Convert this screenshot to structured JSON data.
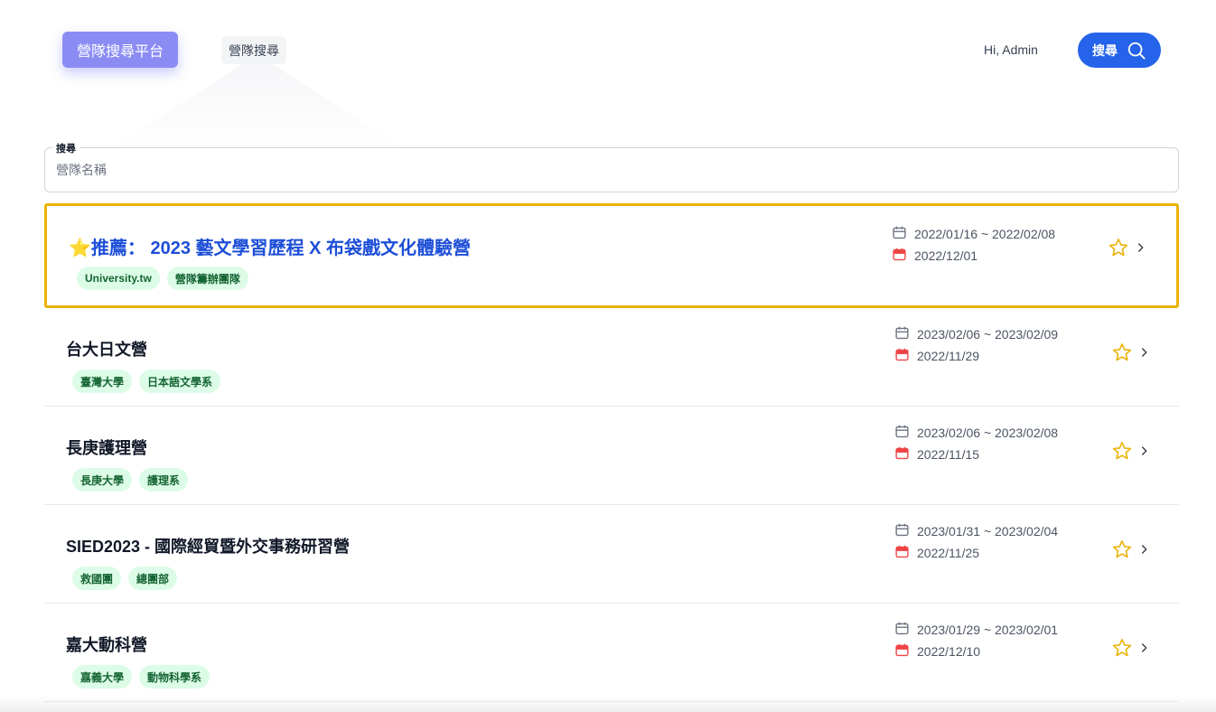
{
  "header": {
    "brand_label": "營隊搜尋平台",
    "nav_label": "營隊搜尋",
    "greeting": "Hi, Admin",
    "search_button_label": "搜尋"
  },
  "search": {
    "label": "搜尋",
    "placeholder": "營隊名稱",
    "value": ""
  },
  "colors": {
    "accent": "#2563eb",
    "brand": "#8b8cf3",
    "featured_border": "#eab308",
    "tag_bg": "#dcfce7",
    "tag_text": "#166534",
    "deadline_icon": "#ef4444",
    "star": "#eab308"
  },
  "camps": [
    {
      "featured": true,
      "title": "⭐推薦： 2023 藝文學習歷程 X 布袋戲文化體驗營",
      "tags": [
        "University.tw",
        "營隊籌辦團隊"
      ],
      "date_range": "2022/01/16 ~ 2022/02/08",
      "deadline": "2022/12/01",
      "icons": [
        "calendar-icon",
        "calendar-deadline-icon",
        "star-outline-icon",
        "chevron-right-icon"
      ]
    },
    {
      "featured": false,
      "title": "台大日文營",
      "tags": [
        "臺灣大學",
        "日本語文學系"
      ],
      "date_range": "2023/02/06 ~ 2023/02/09",
      "deadline": "2022/11/29"
    },
    {
      "featured": false,
      "title": "長庚護理營",
      "tags": [
        "長庚大學",
        "護理系"
      ],
      "date_range": "2023/02/06 ~ 2023/02/08",
      "deadline": "2022/11/15"
    },
    {
      "featured": false,
      "title": "SIED2023 - 國際經貿暨外交事務研習營",
      "tags": [
        "救國團",
        "總團部"
      ],
      "date_range": "2023/01/31 ~ 2023/02/04",
      "deadline": "2022/11/25"
    },
    {
      "featured": false,
      "title": "嘉大動科營",
      "tags": [
        "嘉義大學",
        "動物科學系"
      ],
      "date_range": "2023/01/29 ~ 2023/02/01",
      "deadline": "2022/12/10"
    }
  ]
}
